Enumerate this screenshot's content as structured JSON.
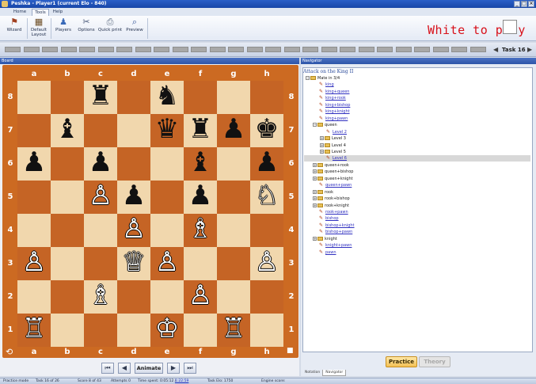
{
  "window": {
    "title": "Peshka - Player1 (current Elo - 840)",
    "buttons": [
      "_",
      "□",
      "×"
    ]
  },
  "tabs": [
    "Home",
    "Tools",
    "Help"
  ],
  "active_tab": "Tools",
  "ribbon": {
    "buttons": [
      {
        "label": "Wizard",
        "icon": "wizard-hat-icon",
        "glyph": "⚑"
      },
      {
        "label": "Default Layout",
        "icon": "layout-icon",
        "glyph": "▦"
      },
      {
        "label": "Players",
        "icon": "players-icon",
        "glyph": "♟"
      },
      {
        "label": "Options",
        "icon": "tools-icon",
        "glyph": "✂"
      },
      {
        "label": "Quick print",
        "icon": "printer-icon",
        "glyph": "⎙"
      },
      {
        "label": "Preview",
        "icon": "preview-icon",
        "glyph": "⌕"
      }
    ]
  },
  "turn_indicator": "White to play",
  "task_nav": {
    "label": "Task 16",
    "prev": "◀",
    "next": "▶"
  },
  "board_panel": {
    "title": "Board"
  },
  "files": [
    "a",
    "b",
    "c",
    "d",
    "e",
    "f",
    "g",
    "h"
  ],
  "ranks": [
    "8",
    "7",
    "6",
    "5",
    "4",
    "3",
    "2",
    "1"
  ],
  "pieces": [
    {
      "sq": "c8",
      "color": "b",
      "glyph": "♜"
    },
    {
      "sq": "e8",
      "color": "b",
      "glyph": "♞"
    },
    {
      "sq": "b7",
      "color": "b",
      "glyph": "♝"
    },
    {
      "sq": "e7",
      "color": "b",
      "glyph": "♛"
    },
    {
      "sq": "f7",
      "color": "b",
      "glyph": "♜"
    },
    {
      "sq": "g7",
      "color": "b",
      "glyph": "♟"
    },
    {
      "sq": "h7",
      "color": "b",
      "glyph": "♚"
    },
    {
      "sq": "a6",
      "color": "b",
      "glyph": "♟"
    },
    {
      "sq": "c6",
      "color": "b",
      "glyph": "♟"
    },
    {
      "sq": "f6",
      "color": "b",
      "glyph": "♝"
    },
    {
      "sq": "h6",
      "color": "b",
      "glyph": "♟"
    },
    {
      "sq": "c5",
      "color": "w",
      "glyph": "♙"
    },
    {
      "sq": "d5",
      "color": "b",
      "glyph": "♟"
    },
    {
      "sq": "f5",
      "color": "b",
      "glyph": "♟"
    },
    {
      "sq": "h5",
      "color": "w",
      "glyph": "♘"
    },
    {
      "sq": "d4",
      "color": "w",
      "glyph": "♙"
    },
    {
      "sq": "f4",
      "color": "w",
      "glyph": "♗"
    },
    {
      "sq": "a3",
      "color": "w",
      "glyph": "♙"
    },
    {
      "sq": "d3",
      "color": "w",
      "glyph": "♕"
    },
    {
      "sq": "e3",
      "color": "w",
      "glyph": "♙"
    },
    {
      "sq": "h3",
      "color": "w",
      "glyph": "♙"
    },
    {
      "sq": "c2",
      "color": "w",
      "glyph": "♗"
    },
    {
      "sq": "f2",
      "color": "w",
      "glyph": "♙"
    },
    {
      "sq": "a1",
      "color": "w",
      "glyph": "♖"
    },
    {
      "sq": "e1",
      "color": "w",
      "glyph": "♔"
    },
    {
      "sq": "g1",
      "color": "w",
      "glyph": "♖"
    }
  ],
  "board_nav": {
    "first": "⏮",
    "prev": "◀",
    "animate": "Animate",
    "next": "▶",
    "last": "⏭"
  },
  "navigator": {
    "panel_title": "Navigator",
    "heading": "Attack on the King II",
    "tree": [
      {
        "depth": 0,
        "tog": "−",
        "type": "folder",
        "label": "Mate in 3/4"
      },
      {
        "depth": 1,
        "type": "link",
        "label": "king"
      },
      {
        "depth": 1,
        "type": "link",
        "label": "king+queen"
      },
      {
        "depth": 1,
        "type": "link",
        "label": "king+rook"
      },
      {
        "depth": 1,
        "type": "link",
        "label": "king+bishop"
      },
      {
        "depth": 1,
        "type": "link",
        "label": "king+knight"
      },
      {
        "depth": 1,
        "type": "link",
        "label": "king+pawn"
      },
      {
        "depth": 1,
        "tog": "−",
        "type": "folder",
        "label": "queen"
      },
      {
        "depth": 2,
        "type": "link",
        "label": "Level 2"
      },
      {
        "depth": 2,
        "tog": "+",
        "type": "folder",
        "label": "Level 3"
      },
      {
        "depth": 2,
        "tog": "+",
        "type": "folder",
        "label": "Level 4"
      },
      {
        "depth": 2,
        "tog": "+",
        "type": "folder",
        "label": "Level 5"
      },
      {
        "depth": 2,
        "type": "link",
        "label": "Level 6",
        "selected": true
      },
      {
        "depth": 1,
        "tog": "+",
        "type": "folder",
        "label": "queen+rook"
      },
      {
        "depth": 1,
        "tog": "+",
        "type": "folder",
        "label": "queen+bishop"
      },
      {
        "depth": 1,
        "tog": "+",
        "type": "folder",
        "label": "queen+knight"
      },
      {
        "depth": 1,
        "type": "link",
        "label": "queen+pawn"
      },
      {
        "depth": 1,
        "tog": "+",
        "type": "folder",
        "label": "rook"
      },
      {
        "depth": 1,
        "tog": "+",
        "type": "folder",
        "label": "rook+bishop"
      },
      {
        "depth": 1,
        "tog": "+",
        "type": "folder",
        "label": "rook+knight"
      },
      {
        "depth": 1,
        "type": "link",
        "label": "rook+pawn"
      },
      {
        "depth": 1,
        "type": "link",
        "label": "bishop"
      },
      {
        "depth": 1,
        "type": "link",
        "label": "bishop+knight"
      },
      {
        "depth": 1,
        "type": "link",
        "label": "bishop+pawn"
      },
      {
        "depth": 1,
        "tog": "+",
        "type": "folder",
        "label": "knight"
      },
      {
        "depth": 1,
        "type": "link",
        "label": "knight+pawn"
      },
      {
        "depth": 1,
        "type": "link",
        "label": "pawn"
      }
    ],
    "practice_label": "Practice",
    "theory_label": "Theory",
    "bottom_tabs": [
      "Notation",
      "Navigator"
    ],
    "active_bottom_tab": "Navigator"
  },
  "status": {
    "mode": "Practice mode",
    "task": "Task 16 of 26",
    "score": "Score 8 of 43",
    "attempts": "Attempts 0",
    "time_label": "Time spent: 0:05:12 /",
    "time_total": "1:22:59",
    "task_elo": "Task Elo: 1750",
    "engine": "Engine score:"
  },
  "colors": {
    "light_square": "#f1d7ad",
    "dark_square": "#c56425",
    "turn_text": "#d8101a",
    "practice_button": "#f3c054"
  }
}
